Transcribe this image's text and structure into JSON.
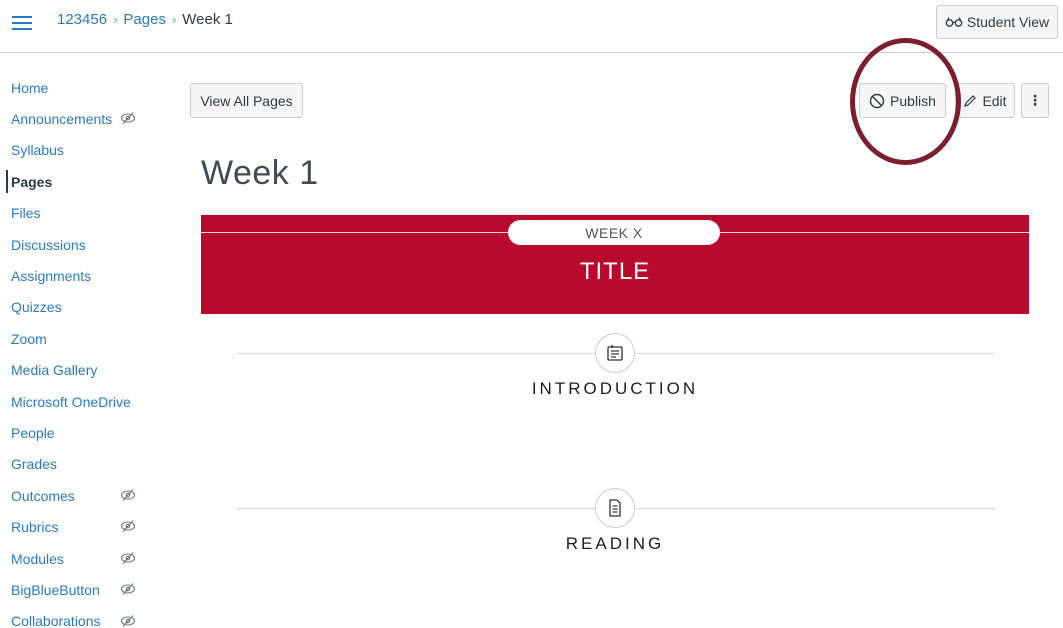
{
  "header": {
    "breadcrumb": [
      "123456",
      "Pages",
      "Week 1"
    ],
    "breadcrumb_sep": "›",
    "student_view_label": "Student View"
  },
  "sidebar": {
    "items": [
      {
        "label": "Home",
        "hidden": false,
        "active": false
      },
      {
        "label": "Announcements",
        "hidden": true,
        "active": false
      },
      {
        "label": "Syllabus",
        "hidden": false,
        "active": false
      },
      {
        "label": "Pages",
        "hidden": false,
        "active": true
      },
      {
        "label": "Files",
        "hidden": false,
        "active": false
      },
      {
        "label": "Discussions",
        "hidden": false,
        "active": false
      },
      {
        "label": "Assignments",
        "hidden": false,
        "active": false
      },
      {
        "label": "Quizzes",
        "hidden": false,
        "active": false
      },
      {
        "label": "Zoom",
        "hidden": false,
        "active": false
      },
      {
        "label": "Media Gallery",
        "hidden": false,
        "active": false
      },
      {
        "label": "Microsoft OneDrive",
        "hidden": false,
        "active": false
      },
      {
        "label": "People",
        "hidden": false,
        "active": false
      },
      {
        "label": "Grades",
        "hidden": false,
        "active": false
      },
      {
        "label": "Outcomes",
        "hidden": true,
        "active": false
      },
      {
        "label": "Rubrics",
        "hidden": true,
        "active": false
      },
      {
        "label": "Modules",
        "hidden": true,
        "active": false
      },
      {
        "label": "BigBlueButton",
        "hidden": true,
        "active": false
      },
      {
        "label": "Collaborations",
        "hidden": true,
        "active": false
      }
    ]
  },
  "toolbar": {
    "view_all_label": "View All Pages",
    "publish_label": "Publish",
    "edit_label": "Edit",
    "more_label": "⋮"
  },
  "page": {
    "title": "Week 1",
    "banner": {
      "week_label": "WEEK X",
      "title": "TITLE",
      "color": "#b90a2e"
    },
    "sections": [
      {
        "heading": "INTRODUCTION",
        "icon": "notepad-icon"
      },
      {
        "heading": "READING",
        "icon": "document-icon"
      }
    ]
  },
  "colors": {
    "link": "#2b7abc",
    "annotation": "#7b1f2e"
  }
}
